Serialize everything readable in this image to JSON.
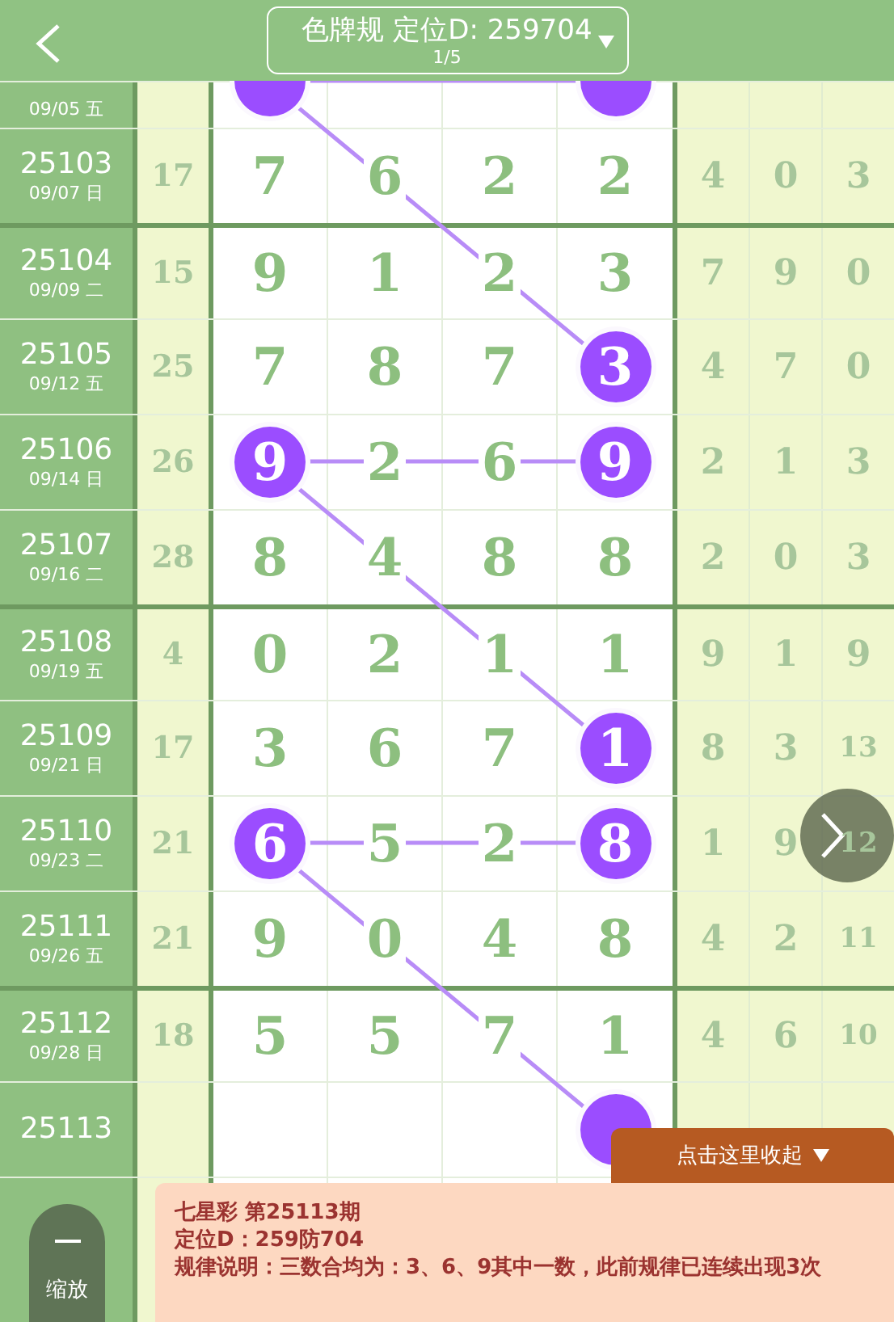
{
  "header": {
    "title": "色牌规 定位D: 259704",
    "page": "1/5"
  },
  "rows": [
    {
      "date": "09/05 五",
      "partial": true,
      "cells": [
        {
          "highlighted": true
        },
        {
          "highlighted": false
        },
        {
          "highlighted": false
        },
        {
          "highlighted": true
        }
      ]
    },
    {
      "issue": "25103",
      "date": "09/07 日",
      "sum": "17",
      "cells": [
        {
          "digit": "7",
          "highlighted": false
        },
        {
          "digit": "6",
          "highlighted": false
        },
        {
          "digit": "2",
          "highlighted": false
        },
        {
          "digit": "2",
          "highlighted": false
        }
      ],
      "extra": [
        "4",
        "0",
        "3"
      ]
    },
    {
      "issue": "25104",
      "date": "09/09 二",
      "sum": "15",
      "cells": [
        {
          "digit": "9",
          "highlighted": false
        },
        {
          "digit": "1",
          "highlighted": false
        },
        {
          "digit": "2",
          "highlighted": false
        },
        {
          "digit": "3",
          "highlighted": false
        }
      ],
      "extra": [
        "7",
        "9",
        "0"
      ]
    },
    {
      "issue": "25105",
      "date": "09/12 五",
      "sum": "25",
      "cells": [
        {
          "digit": "7",
          "highlighted": false
        },
        {
          "digit": "8",
          "highlighted": false
        },
        {
          "digit": "7",
          "highlighted": false
        },
        {
          "digit": "3",
          "highlighted": true
        }
      ],
      "extra": [
        "4",
        "7",
        "0"
      ]
    },
    {
      "issue": "25106",
      "date": "09/14 日",
      "sum": "26",
      "cells": [
        {
          "digit": "9",
          "highlighted": true
        },
        {
          "digit": "2",
          "highlighted": false
        },
        {
          "digit": "6",
          "highlighted": false
        },
        {
          "digit": "9",
          "highlighted": true
        }
      ],
      "extra": [
        "2",
        "1",
        "3"
      ]
    },
    {
      "issue": "25107",
      "date": "09/16 二",
      "sum": "28",
      "cells": [
        {
          "digit": "8",
          "highlighted": false
        },
        {
          "digit": "4",
          "highlighted": false
        },
        {
          "digit": "8",
          "highlighted": false
        },
        {
          "digit": "8",
          "highlighted": false
        }
      ],
      "extra": [
        "2",
        "0",
        "3"
      ]
    },
    {
      "issue": "25108",
      "date": "09/19 五",
      "sum": "4",
      "cells": [
        {
          "digit": "0",
          "highlighted": false
        },
        {
          "digit": "2",
          "highlighted": false
        },
        {
          "digit": "1",
          "highlighted": false
        },
        {
          "digit": "1",
          "highlighted": false
        }
      ],
      "extra": [
        "9",
        "1",
        "9"
      ]
    },
    {
      "issue": "25109",
      "date": "09/21 日",
      "sum": "17",
      "cells": [
        {
          "digit": "3",
          "highlighted": false
        },
        {
          "digit": "6",
          "highlighted": false
        },
        {
          "digit": "7",
          "highlighted": false
        },
        {
          "digit": "1",
          "highlighted": true
        }
      ],
      "extra": [
        "8",
        "3",
        "13"
      ]
    },
    {
      "issue": "25110",
      "date": "09/23 二",
      "sum": "21",
      "cells": [
        {
          "digit": "6",
          "highlighted": true
        },
        {
          "digit": "5",
          "highlighted": false
        },
        {
          "digit": "2",
          "highlighted": false
        },
        {
          "digit": "8",
          "highlighted": true
        }
      ],
      "extra": [
        "1",
        "9",
        "12"
      ]
    },
    {
      "issue": "25111",
      "date": "09/26 五",
      "sum": "21",
      "cells": [
        {
          "digit": "9",
          "highlighted": false
        },
        {
          "digit": "0",
          "highlighted": false
        },
        {
          "digit": "4",
          "highlighted": false
        },
        {
          "digit": "8",
          "highlighted": false
        }
      ],
      "extra": [
        "4",
        "2",
        "11"
      ]
    },
    {
      "issue": "25112",
      "date": "09/28 日",
      "sum": "18",
      "cells": [
        {
          "digit": "5",
          "highlighted": false
        },
        {
          "digit": "5",
          "highlighted": false
        },
        {
          "digit": "7",
          "highlighted": false
        },
        {
          "digit": "1",
          "highlighted": false
        }
      ],
      "extra": [
        "4",
        "6",
        "10"
      ]
    },
    {
      "issue": "25113",
      "cells": [
        {
          "highlighted": false
        },
        {
          "highlighted": false
        },
        {
          "highlighted": false
        },
        {
          "highlighted": true
        }
      ]
    }
  ],
  "zoom": {
    "label": "缩放"
  },
  "popup": {
    "toggle": "点击这里收起",
    "lines": [
      "七星彩 第25113期",
      "定位D：259防704",
      "规律说明：三数合均为：3、6、9其中一数，此前规律已连续出现3次"
    ]
  }
}
